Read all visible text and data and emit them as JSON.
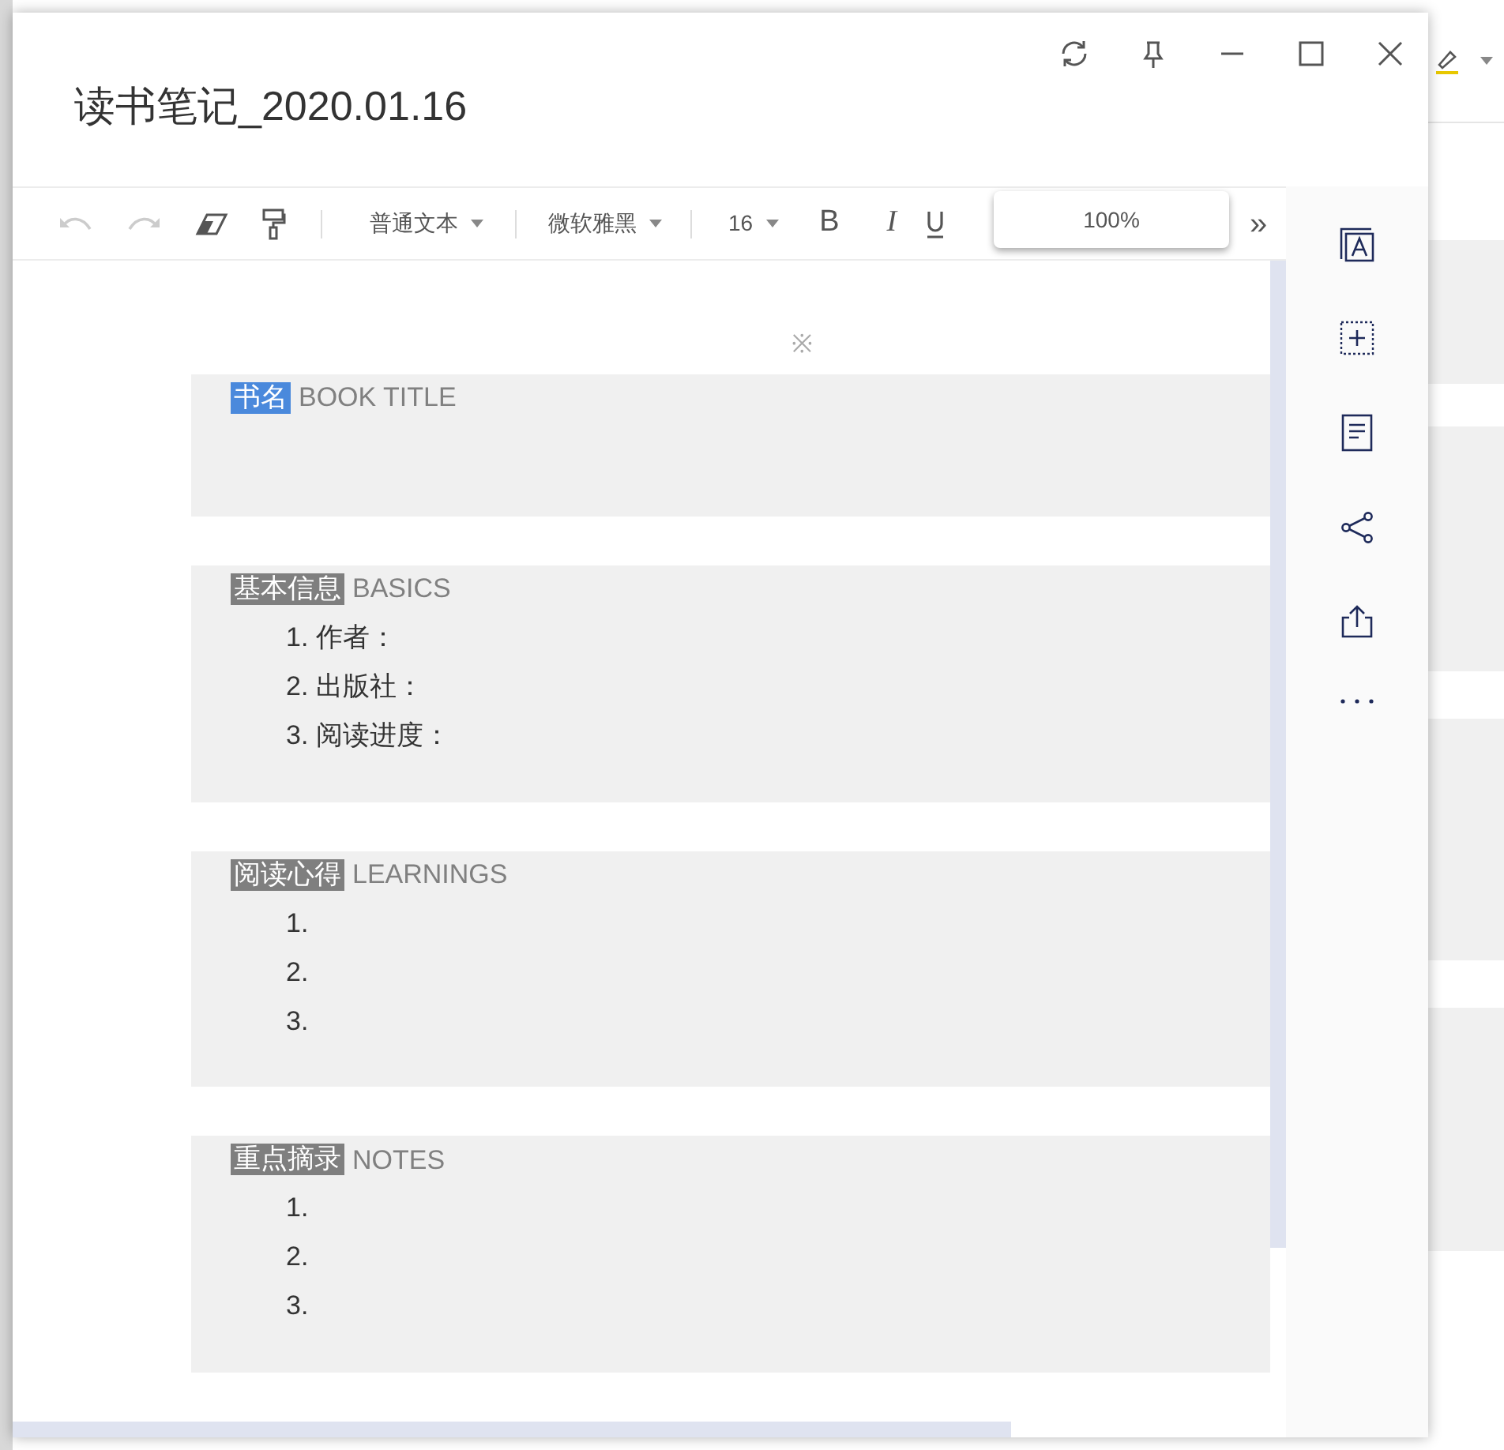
{
  "window": {
    "title": "读书笔记_2020.01.16"
  },
  "toolbar": {
    "paragraph_style": "普通文本",
    "font": "微软雅黑",
    "font_size": "16",
    "bold": "B",
    "italic": "I",
    "more": "»",
    "undo_disabled": true,
    "redo_disabled": true
  },
  "zoom_popup": {
    "value": "100%"
  },
  "note": {
    "mark": "※",
    "sections": [
      {
        "tag": "书名",
        "color": "#4a89dc",
        "heading": "BOOK TITLE"
      },
      {
        "tag": "基本信息",
        "color": "#7f7f7f",
        "heading": "BASICS",
        "items": [
          {
            "number": "1.",
            "text": "作者："
          },
          {
            "number": "2.",
            "text": "出版社："
          },
          {
            "number": "3.",
            "text": "阅读进度："
          }
        ]
      },
      {
        "tag": "阅读心得",
        "color": "#7f7f7f",
        "heading": "LEARNINGS",
        "items": [
          {
            "number": "1."
          },
          {
            "number": "2."
          },
          {
            "number": "3."
          }
        ]
      },
      {
        "tag": "重点摘录",
        "color": "#7f7f7f",
        "heading": "NOTES",
        "items": [
          {
            "number": "1."
          },
          {
            "number": "2."
          },
          {
            "number": "3."
          }
        ]
      }
    ]
  }
}
